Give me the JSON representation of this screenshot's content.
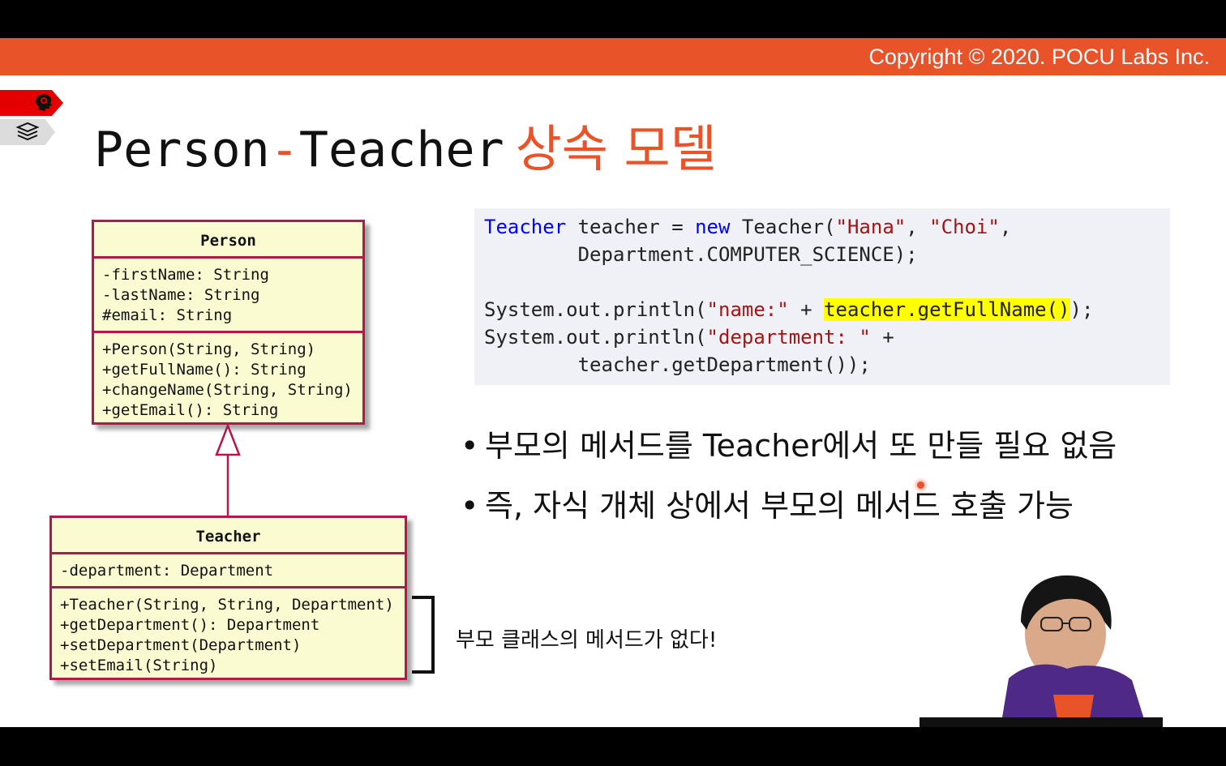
{
  "header": {
    "copyright": "Copyright © 2020. POCU Labs Inc."
  },
  "title": {
    "part1": "Person",
    "dash": "-",
    "part2": "Teacher",
    "korean": "상속 모델"
  },
  "uml": {
    "person": {
      "name": "Person",
      "fields": [
        "-firstName: String",
        "-lastName: String",
        "#email: String"
      ],
      "methods": [
        "+Person(String, String)",
        "+getFullName(): String",
        "+changeName(String, String)",
        "+getEmail(): String"
      ]
    },
    "teacher": {
      "name": "Teacher",
      "fields": [
        "-department: Department"
      ],
      "methods": [
        "+Teacher(String, String, Department)",
        "+getDepartment(): Department",
        "+setDepartment(Department)",
        "+setEmail(String)"
      ]
    }
  },
  "code": {
    "l1_type": "Teacher",
    "l1_a": " teacher = ",
    "l1_new": "new",
    "l1_b": " Teacher(",
    "l1_s1": "\"Hana\"",
    "l1_c": ", ",
    "l1_s2": "\"Choi\"",
    "l1_d": ",",
    "l2": "        Department.COMPUTER_SCIENCE);",
    "l4_a": "System.out.println(",
    "l4_s": "\"name:\"",
    "l4_b": " + ",
    "l4_hl": "teacher.getFullName()",
    "l4_c": ");",
    "l5_a": "System.out.println(",
    "l5_s": "\"department: \"",
    "l5_b": " +",
    "l6": "        teacher.getDepartment());"
  },
  "bullets": [
    "부모의 메서드를 Teacher에서 또 만들 필요 없음",
    "즉, 자식 개체 상에서 부모의 메서드 호출 가능"
  ],
  "bullet_symbol": "•",
  "note": "부모 클래스의 메서드가 없다!",
  "colors": {
    "accent": "#e8532a",
    "uml_border": "#b5174a",
    "uml_fill": "#fbfbd2",
    "keyword": "#0000ff",
    "string": "#a31515",
    "highlight": "#ffff00"
  },
  "icons": [
    "brain-head-icon",
    "books-stack-icon"
  ]
}
